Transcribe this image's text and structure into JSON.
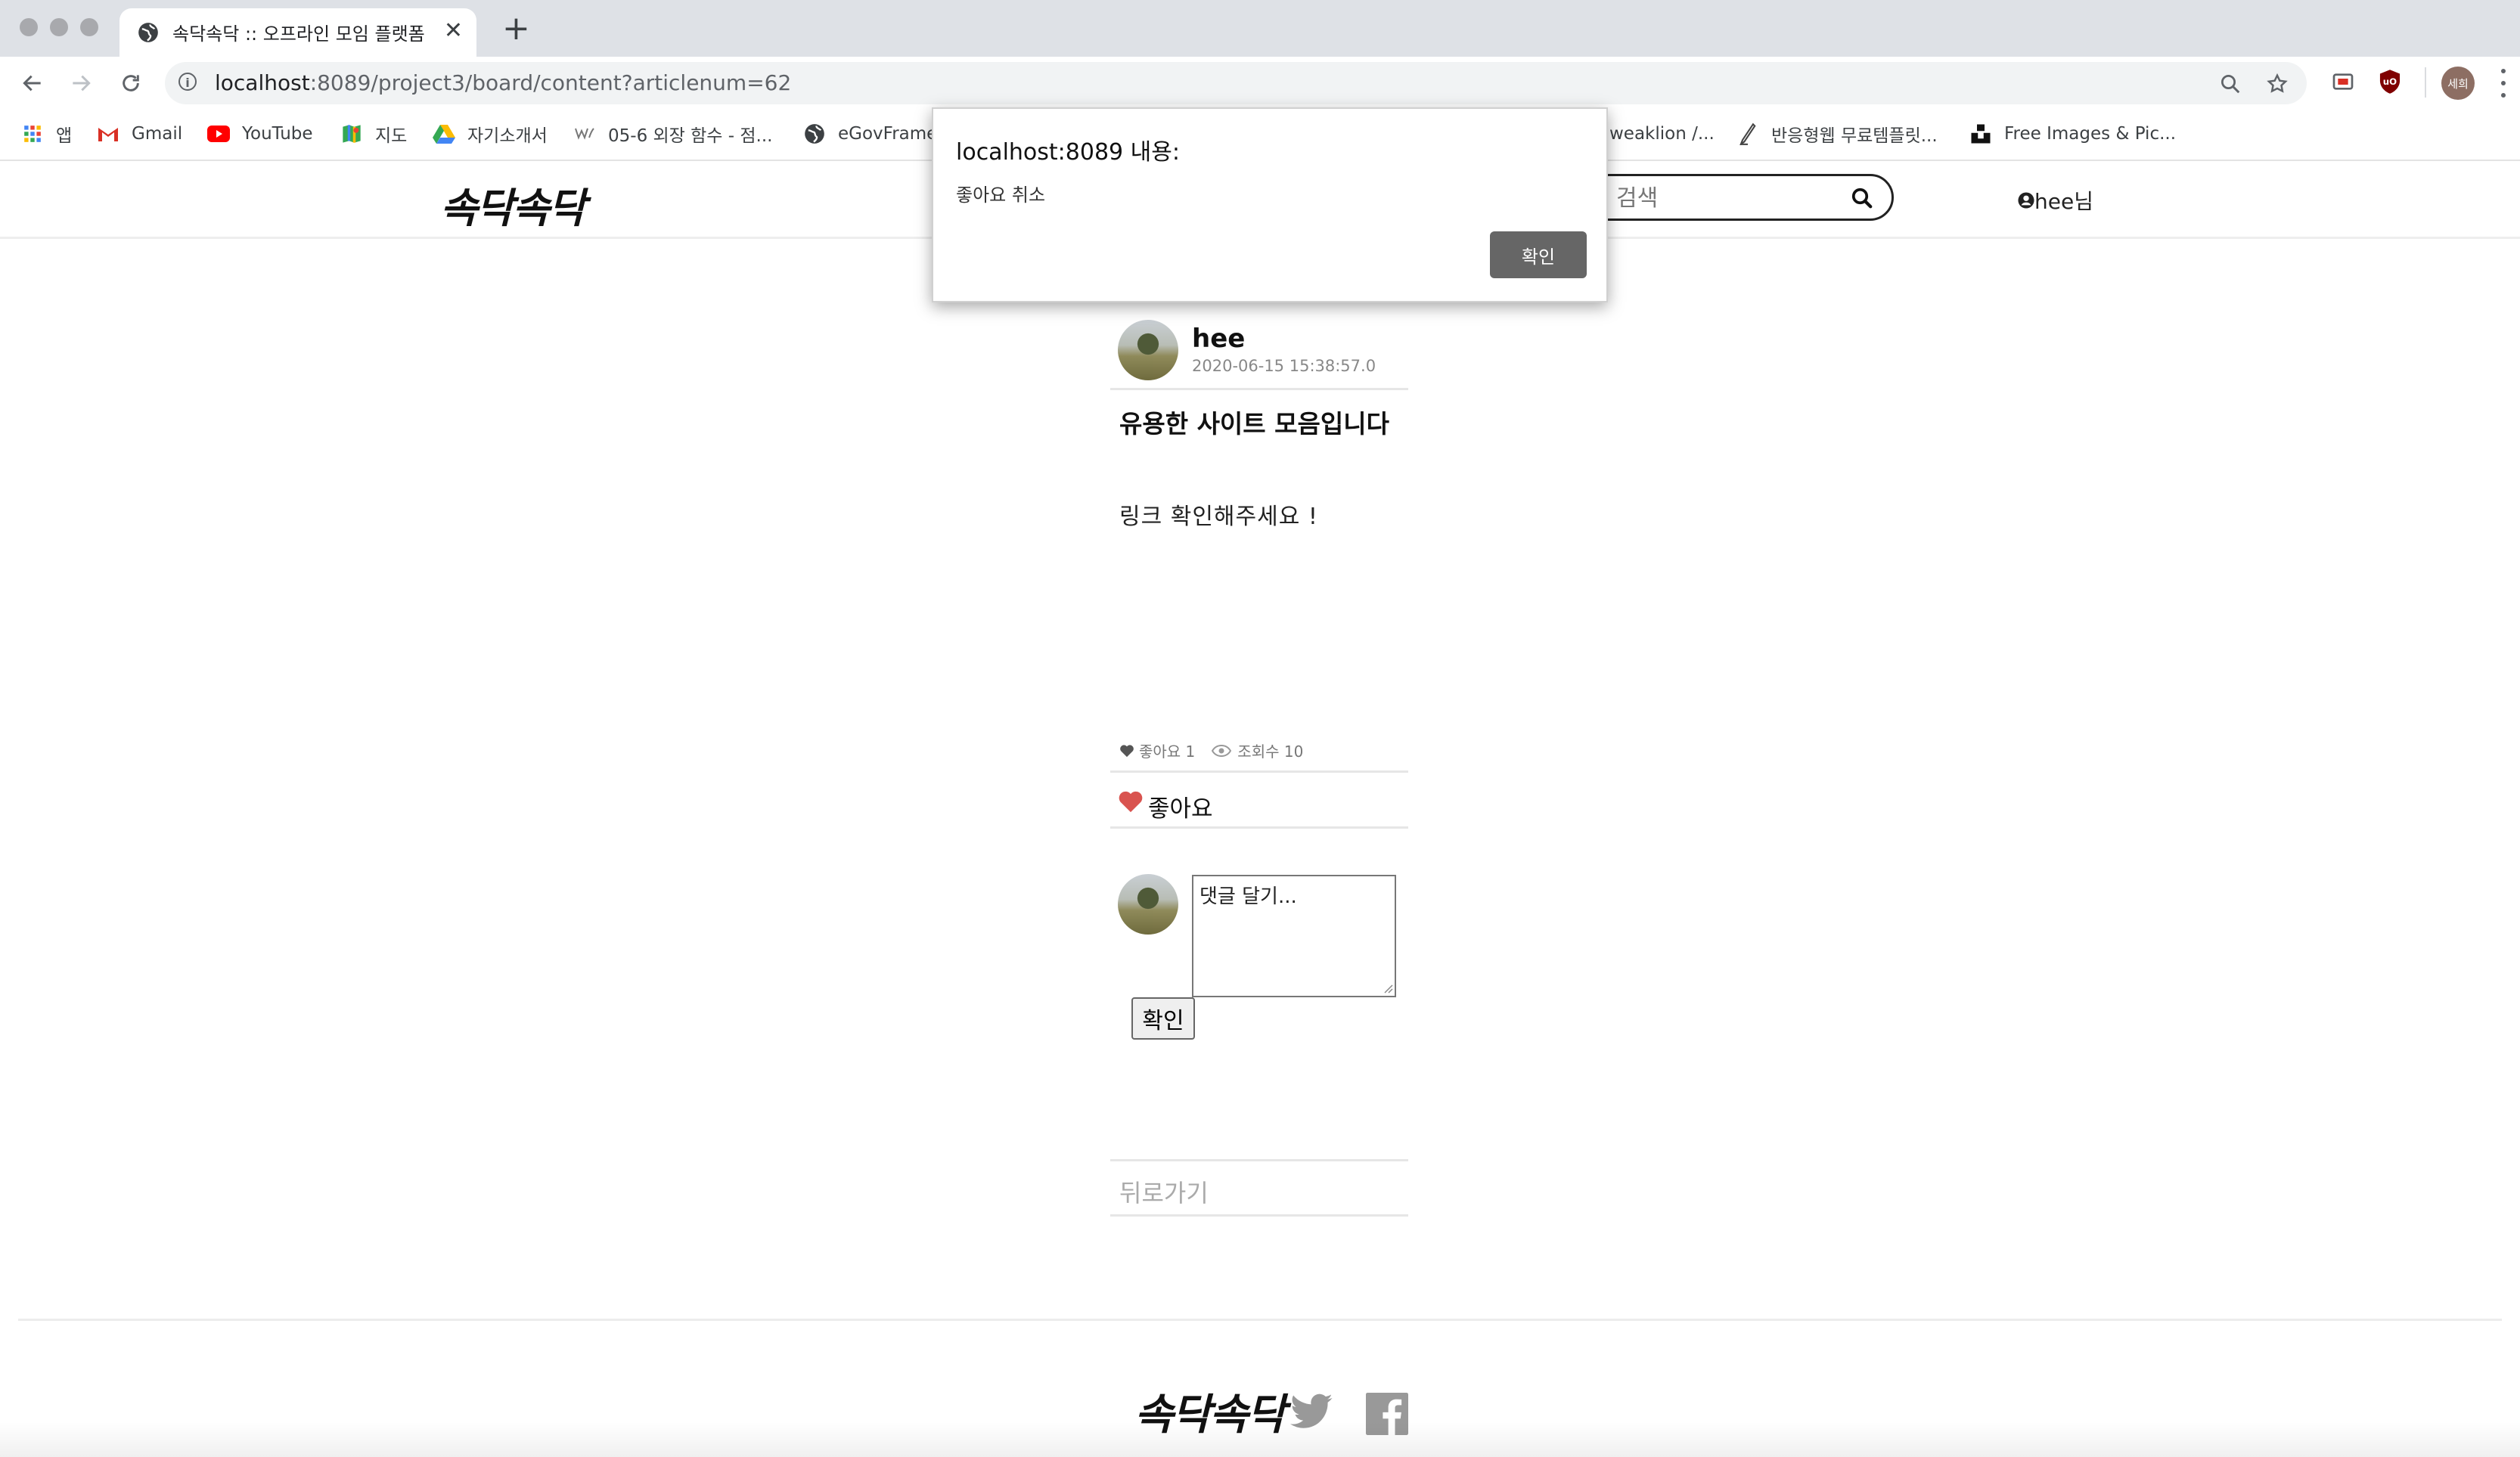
{
  "browser": {
    "tab_title": "속닥속닥 :: 오프라인 모임 플랫폼",
    "tab_close": "✕",
    "new_tab": "+",
    "url_host": "localhost",
    "url_path": ":8089/project3/board/content?articlenum=62",
    "profile_label": "세희",
    "bookmarks": [
      {
        "label": "앱",
        "icon": "apps-grid-icon"
      },
      {
        "label": "Gmail",
        "icon": "gmail-icon"
      },
      {
        "label": "YouTube",
        "icon": "youtube-icon"
      },
      {
        "label": "지도",
        "icon": "maps-icon"
      },
      {
        "label": "자기소개서",
        "icon": "drive-icon"
      },
      {
        "label": "05-6 외장 함수 - 점...",
        "icon": "wikidocs-icon"
      },
      {
        "label": "eGovFrame",
        "icon": "globe-icon"
      },
      {
        "label": "weaklion /...",
        "icon": "none"
      },
      {
        "label": "반응형웹 무료템플릿...",
        "icon": "pen-icon"
      },
      {
        "label": "Free Images & Pic...",
        "icon": "unsplash-icon"
      }
    ]
  },
  "site": {
    "logo": "속닥속닥",
    "search_placeholder": "검색",
    "user_label": "hee님",
    "footer_logo": "속닥속닥"
  },
  "article": {
    "author": "hee",
    "date": "2020-06-15 15:38:57.0",
    "title": "유용한 사이트 모음입니다",
    "body": "링크  확인해주세요  !",
    "likes_label": "좋아요 1",
    "views_label": "조회수 10",
    "like_button": "좋아요",
    "comment_placeholder": "댓글 달기...",
    "comment_submit": "확인",
    "back_label": "뒤로가기"
  },
  "dialog": {
    "title": "localhost:8089 내용:",
    "message": "좋아요 취소",
    "ok_label": "확인"
  },
  "colors": {
    "chrome_tabstrip": "#dee1e6",
    "omnibox": "#f1f3f4",
    "heart": "#d9534f",
    "dialog_button": "#666666"
  }
}
